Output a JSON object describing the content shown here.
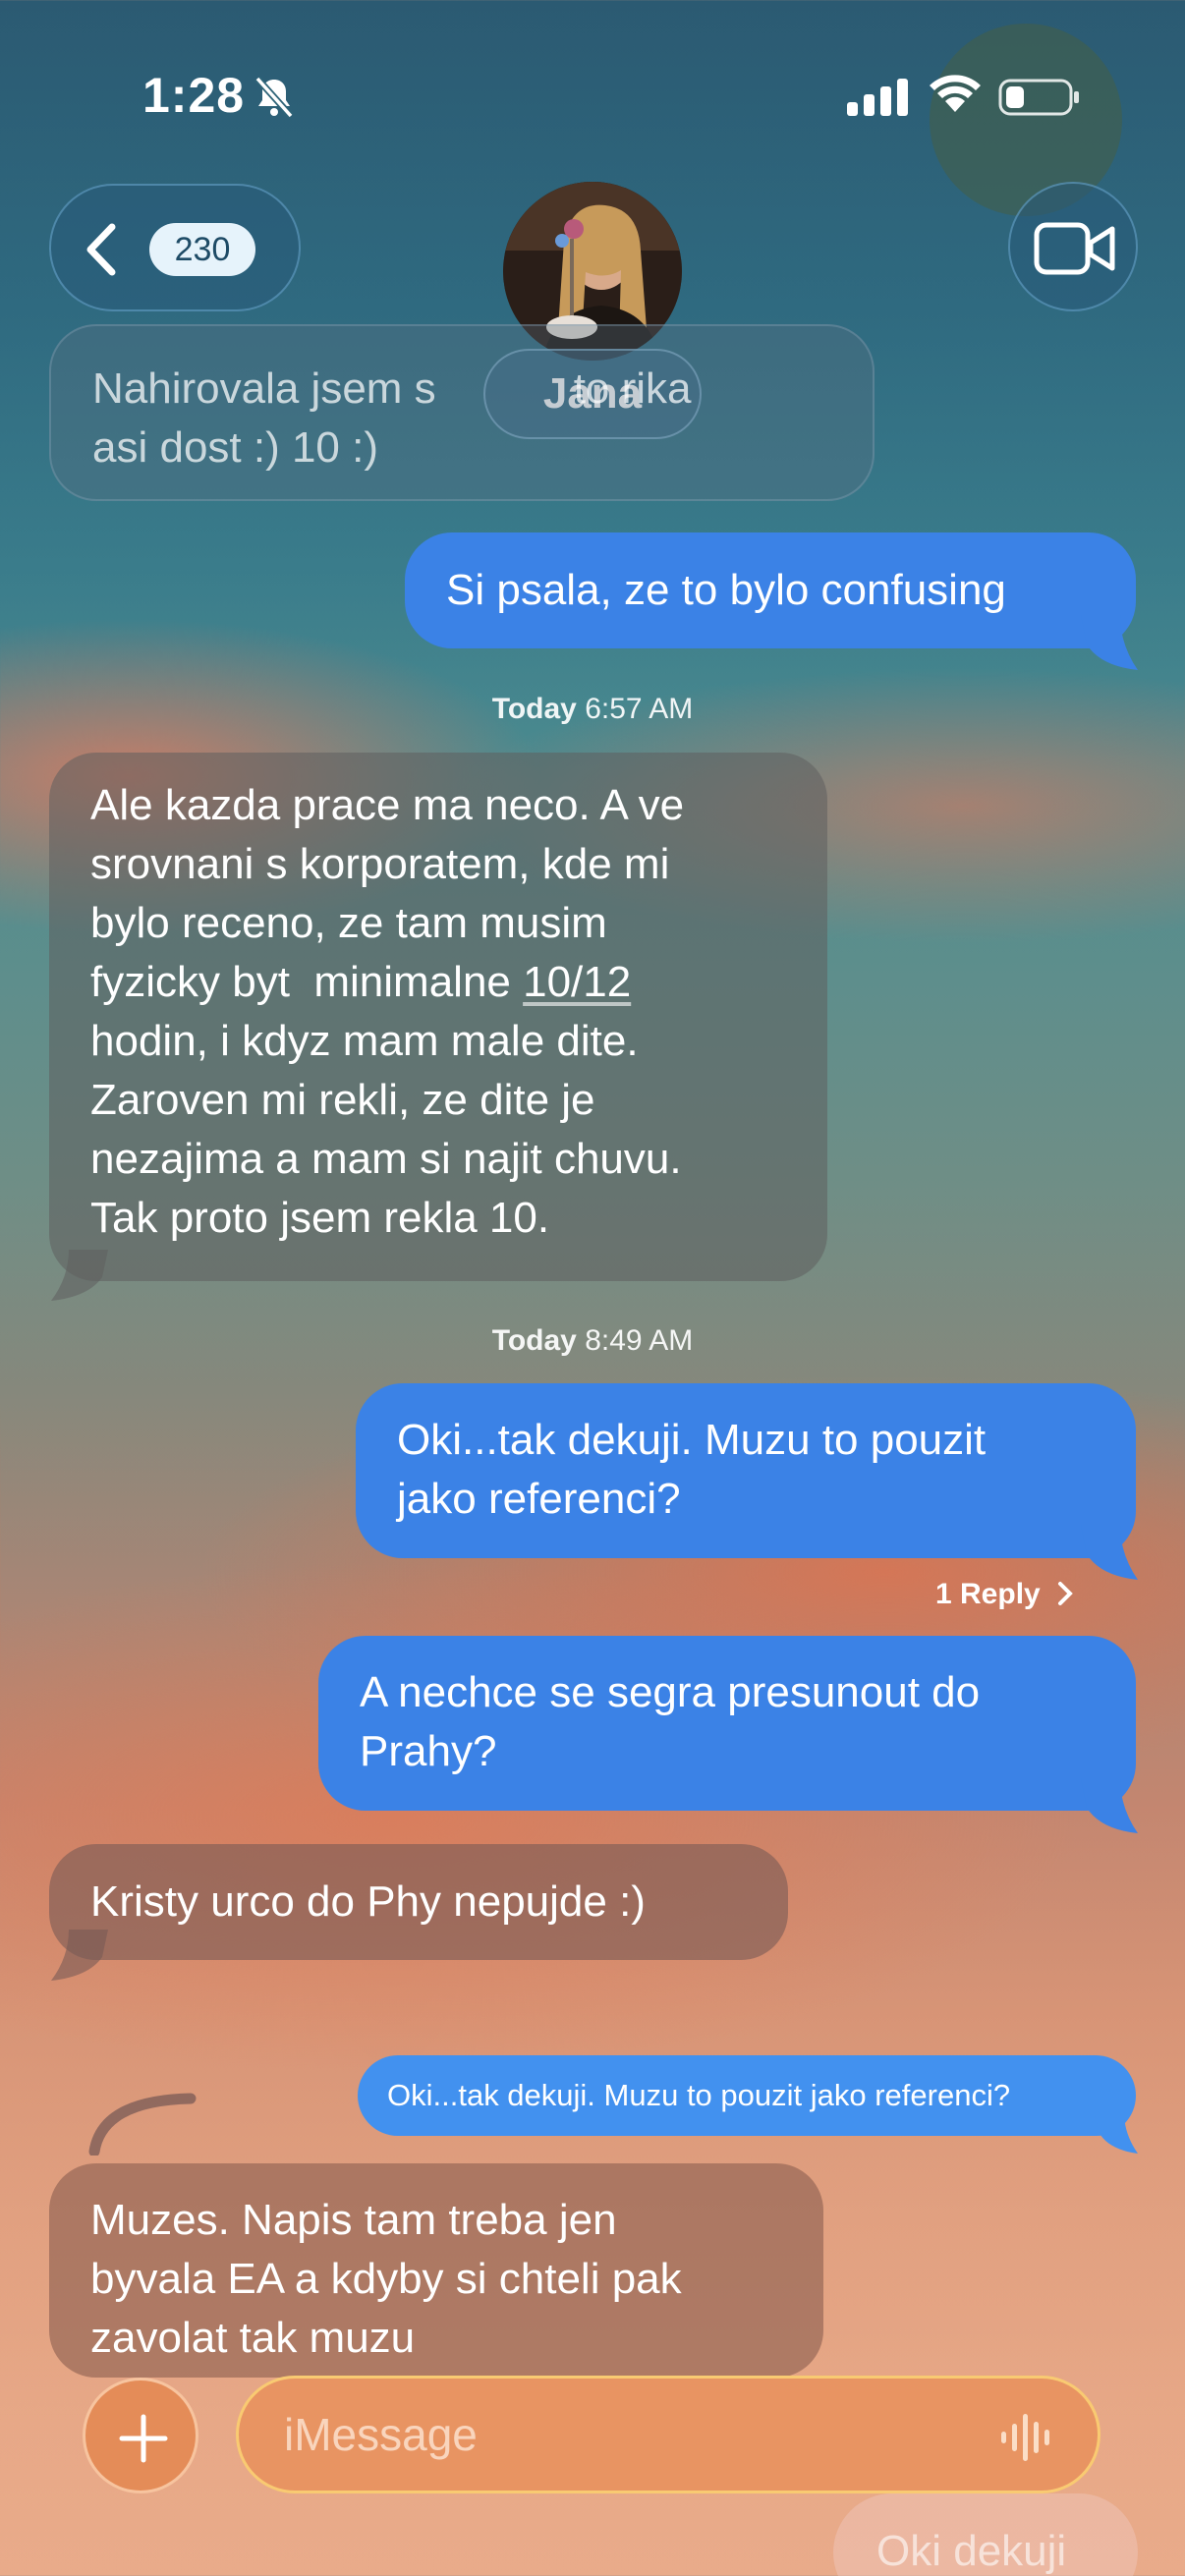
{
  "status_bar": {
    "time": "1:28",
    "silent": true,
    "signal": "cellular",
    "wifi": true,
    "battery_level": 0.25
  },
  "header": {
    "back_count": "230",
    "contact_name": "Jana",
    "video_call_icon": "video-camera-icon"
  },
  "messages": [
    {
      "direction": "in",
      "text_line1": "Nahirovala jsem s",
      "text_line1_end": "to rika",
      "text_line2": "asi dost :) 10 :)"
    },
    {
      "direction": "out",
      "text": "Si psala, ze to bylo confusing"
    },
    {
      "type": "timestamp",
      "day": "Today",
      "time": "6:57 AM"
    },
    {
      "direction": "in",
      "lines": [
        "Ale kazda prace ma neco. A ve",
        "srovnani s korporatem, kde mi",
        "bylo receno, ze tam musim"
      ],
      "line4_pre": "fyzicky byt  minimalne ",
      "line4_link": "10/12",
      "lines_rest": [
        "hodin, i kdyz mam male dite.",
        "Zaroven mi rekli, ze dite je",
        "nezajima a mam si najit chuvu.",
        "Tak proto jsem rekla 10."
      ]
    },
    {
      "type": "timestamp",
      "day": "Today",
      "time": "8:49 AM"
    },
    {
      "direction": "out",
      "lines": [
        "Oki...tak dekuji. Muzu to pouzit",
        "jako referenci?"
      ]
    },
    {
      "type": "reply_link",
      "text": "1 Reply"
    },
    {
      "direction": "out",
      "lines": [
        "A nechce se segra presunout do",
        "Prahy?"
      ]
    },
    {
      "direction": "in",
      "text": "Kristy urco do Phy nepujde :)"
    },
    {
      "direction": "out",
      "type": "quoted",
      "text": "Oki...tak dekuji. Muzu to pouzit jako referenci?"
    },
    {
      "direction": "in",
      "lines": [
        "Muzes. Napis tam treba jen",
        "byvala EA a kdyby si chteli pak",
        "zavolat tak muzu"
      ]
    }
  ],
  "compose": {
    "placeholder": "iMessage",
    "draft": "Oki dekuji"
  },
  "colors": {
    "outgoing": "#3b82e6",
    "incoming": "rgba(95,95,95,0.55)",
    "compose": "#e89462"
  }
}
